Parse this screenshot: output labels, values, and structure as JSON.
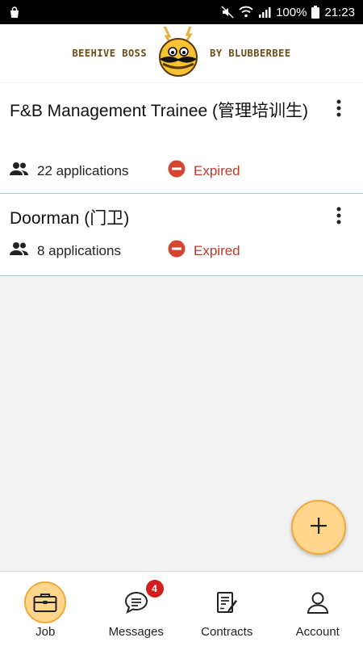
{
  "status_bar": {
    "battery": "100%",
    "time": "21:23"
  },
  "header": {
    "brand_left": "BEEHIVE BOSS",
    "brand_right": "BY BLUBBERBEE"
  },
  "jobs": [
    {
      "title": "F&B Management Trainee (管理培训生)",
      "applications": "22 applications",
      "status": "Expired"
    },
    {
      "title": "Doorman (门卫)",
      "applications": "8 applications",
      "status": "Expired"
    }
  ],
  "bottom_nav": {
    "items": [
      {
        "label": "Job",
        "icon": "briefcase-icon",
        "active": true
      },
      {
        "label": "Messages",
        "icon": "chat-icon",
        "badge": "4"
      },
      {
        "label": "Contracts",
        "icon": "contract-icon"
      },
      {
        "label": "Account",
        "icon": "user-icon"
      }
    ]
  },
  "colors": {
    "accent": "#ffd68c",
    "accent_border": "#f0a93b",
    "expired": "#c0392b",
    "divider": "#9fd0c8"
  }
}
